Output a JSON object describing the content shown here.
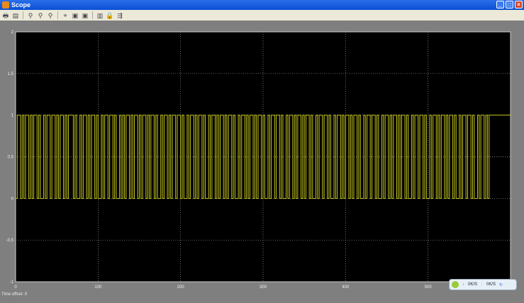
{
  "window": {
    "title": "Scope",
    "buttons": [
      "_",
      "□",
      "×"
    ]
  },
  "toolbar": {
    "icons": [
      "print-icon",
      "parameters-icon",
      "zoom-icon",
      "zoom-x-icon",
      "zoom-y-icon",
      "autoscale-icon",
      "save-axes-icon",
      "restore-axes-icon",
      "floating-scope-icon",
      "lock-axes-icon",
      "signal-selection-icon"
    ]
  },
  "status": {
    "time_offset_label": "Time offset:",
    "time_offset_value": "0"
  },
  "tray": {
    "down": "0K/S",
    "up": "0K/S"
  },
  "colors": {
    "signal": "#c8c81e",
    "axes_bg": "#000000",
    "grid": "#9a9a9a",
    "window_bg": "#7f7f7f"
  },
  "chart_data": {
    "type": "line",
    "step": true,
    "title": "",
    "xlabel": "",
    "ylabel": "",
    "xlim": [
      0,
      600
    ],
    "ylim": [
      -1,
      2
    ],
    "xticks": [
      0,
      100,
      200,
      300,
      400,
      500
    ],
    "yticks": [
      -1,
      -0.5,
      0,
      0.5,
      1,
      1.5,
      2
    ],
    "xtick_labels": [
      "0",
      "100",
      "200",
      "300",
      "400",
      "500"
    ],
    "ytick_labels": [
      "-1",
      "-0.5",
      "0",
      "0.5",
      "1",
      "1.5",
      "2"
    ],
    "grid": true,
    "series": [
      {
        "sample_time": 2,
        "levels": [
          0,
          1
        ],
        "bits": "011010110101101001011011010110101110100101101011010010110110100101011010110101101011010010110101101101001011010110100101101011010110100101101011010110100101101101001011010110101101001011011010010110101101011010010110110100101101011010110100101101101001011010110101101001011011010010110101"
      }
    ]
  }
}
